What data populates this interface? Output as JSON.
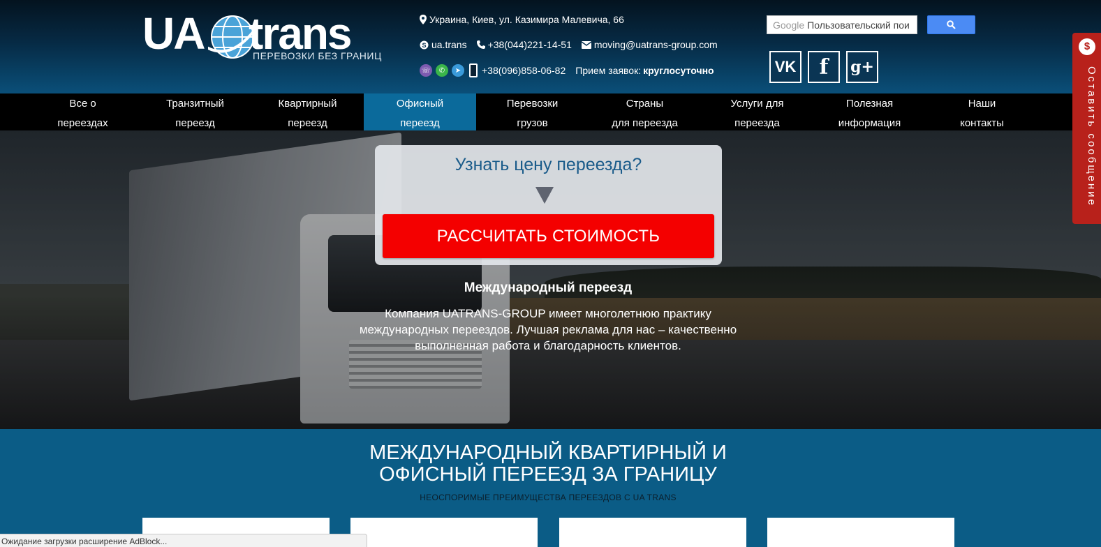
{
  "header": {
    "logo": {
      "ua": "UA",
      "trans": "trans",
      "tagline": "ПЕРЕВОЗКИ БЕЗ ГРАНИЦ"
    },
    "address": "Украина, Киев, ул. Казимира Малевича, 66",
    "skype": "ua.trans",
    "phone1": "+38(044)221-14-51",
    "email": "moving@uatrans-group.com",
    "phone2": "+38(096)858-06-82",
    "hours_label": "Прием заявок:",
    "hours_value": "круглосуточно",
    "search": {
      "brand": "Google",
      "placeholder": "Пользовательский пои"
    },
    "social": {
      "vk": "vk",
      "fb": "f",
      "gp": "g+"
    }
  },
  "nav": [
    {
      "line1": "Все о",
      "line2": "переездах"
    },
    {
      "line1": "Транзитный",
      "line2": "переезд"
    },
    {
      "line1": "Квартирный",
      "line2": "переезд"
    },
    {
      "line1": "Офисный",
      "line2": "переезд",
      "active": true
    },
    {
      "line1": "Перевозки",
      "line2": "грузов"
    },
    {
      "line1": "Страны",
      "line2": "для переезда"
    },
    {
      "line1": "Услуги для",
      "line2": "переезда"
    },
    {
      "line1": "Полезная",
      "line2": "информация"
    },
    {
      "line1": "Наши",
      "line2": "контакты"
    }
  ],
  "hero": {
    "question": "Узнать цену переезда?",
    "cta": "РАССЧИТАТЬ СТОИМОСТЬ",
    "title": "Международный переезд",
    "text": "Компания UATRANS-GROUP имеет многолетнюю практику международных переездов. Лучшая реклама для нас – качественно выполненная работа и благодарность клиентов."
  },
  "feedback": {
    "label": "Оставить сообщение"
  },
  "section": {
    "title_line1": "МЕЖДУНАРОДНЫЙ КВАРТИРНЫЙ И",
    "title_line2": "ОФИСНЫЙ ПЕРЕЕЗД ЗА ГРАНИЦУ",
    "subtitle": "НЕОСПОРИМЫЕ ПРЕИМУЩЕСТВА ПЕРЕЕЗДОВ С UA TRANS"
  },
  "status_bar": "Ожидание загрузки расширение AdBlock...",
  "colors": {
    "accent": "#0b6a9b",
    "cta": "#f40000",
    "feedback": "#b8211b"
  }
}
